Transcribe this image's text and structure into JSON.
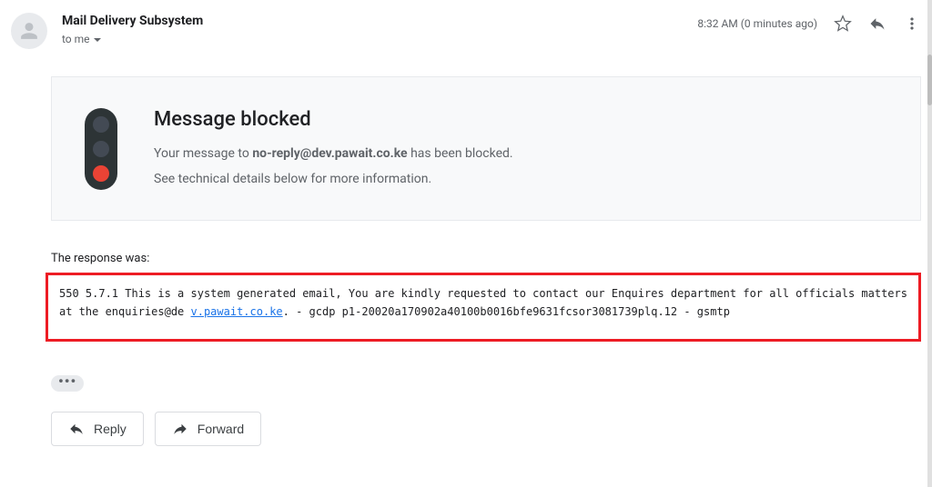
{
  "header": {
    "sender": "Mail Delivery Subsystem",
    "to_prefix": "to me",
    "timestamp": "8:32 AM (0 minutes ago)"
  },
  "card": {
    "title": "Message blocked",
    "line1_before": "Your message to ",
    "line1_bold": "no-reply@dev.pawait.co.ke",
    "line1_after": " has been blocked.",
    "line2": "See technical details below for more information."
  },
  "response": {
    "label": "The response was:",
    "text_before": "550 5.7.1 This is a system generated email, You are kindly requested to contact our Enquires department for all officials matters at the enquiries@de ",
    "link_text": "v.pawait.co.ke",
    "text_after": ". - gcdp p1-20020a170902a40100b0016bfe9631fcsor3081739plq.12 - gsmtp"
  },
  "actions": {
    "reply": "Reply",
    "forward": "Forward",
    "trimmed": "•••"
  }
}
